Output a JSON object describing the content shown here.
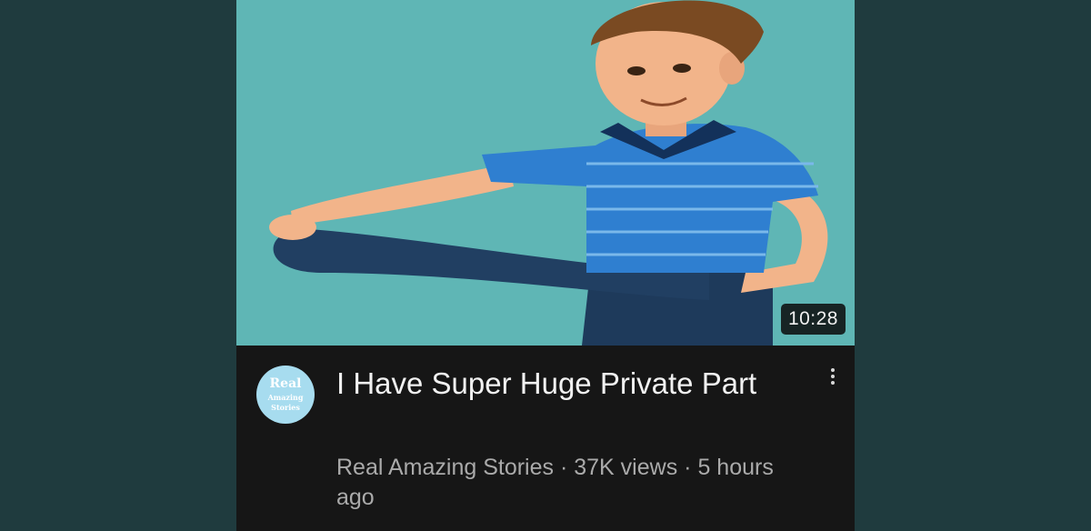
{
  "video": {
    "duration": "10:28",
    "title": "I Have Super Huge Private Part",
    "channel": "Real Amazing Stories",
    "separator": "·",
    "views": "37K views",
    "age": "5 hours ago"
  },
  "avatar": {
    "line1": "Real",
    "line2": "Amazing",
    "line3": "Stories"
  },
  "colors": {
    "background": "#1f3b3e",
    "thumbnail_bg": "#5fb6b5",
    "panel": "#161616",
    "shirt": "#2f7fd0",
    "pants": "#1e3a5b",
    "skin": "#f2b48a",
    "hair": "#7a4a22"
  },
  "icons": {
    "menu": "more-vertical-icon"
  }
}
